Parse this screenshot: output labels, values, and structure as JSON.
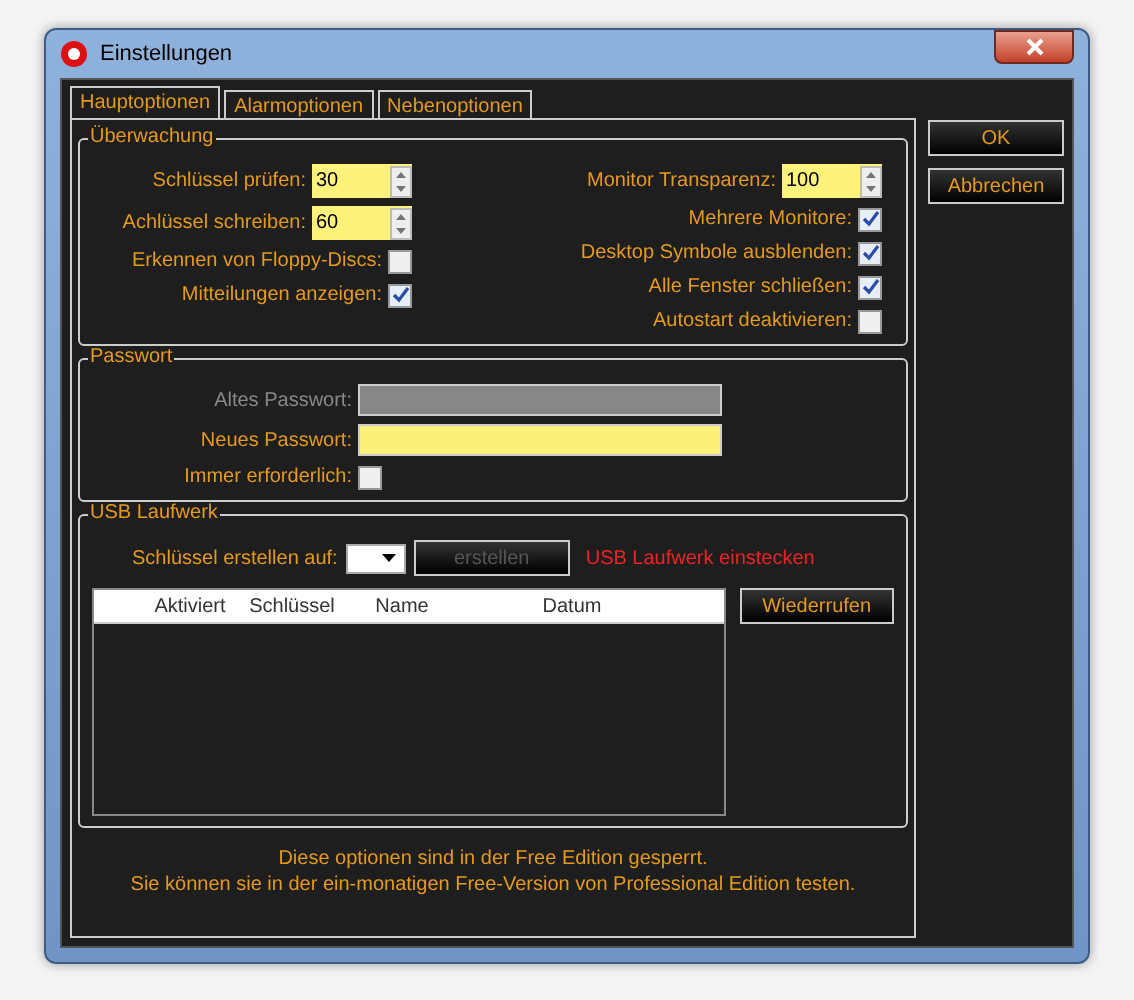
{
  "window": {
    "title": "Einstellungen"
  },
  "tabs": [
    {
      "label": "Hauptoptionen",
      "selected": true
    },
    {
      "label": "Alarmoptionen",
      "selected": false
    },
    {
      "label": "Nebenoptionen",
      "selected": false
    }
  ],
  "side_buttons": [
    "OK",
    "Abbrechen"
  ],
  "ueberwachung": {
    "title": "Überwachung",
    "left": [
      {
        "kind": "spinner",
        "label": "Schlüssel prüfen:",
        "value": "30"
      },
      {
        "kind": "spinner",
        "label": "Achlüssel schreiben:",
        "value": "60"
      },
      {
        "kind": "checkbox",
        "label": "Erkennen von Floppy-Discs:",
        "checked": false
      },
      {
        "kind": "checkbox",
        "label": "Mitteilungen anzeigen:",
        "checked": true
      }
    ],
    "right": [
      {
        "kind": "spinner",
        "label": "Monitor Transparenz:",
        "value": "100"
      },
      {
        "kind": "checkbox",
        "label": "Mehrere Monitore:",
        "checked": true
      },
      {
        "kind": "checkbox",
        "label": "Desktop Symbole ausblenden:",
        "checked": true
      },
      {
        "kind": "checkbox",
        "label": "Alle Fenster schließen:",
        "checked": true
      },
      {
        "kind": "checkbox",
        "label": "Autostart deaktivieren:",
        "checked": false
      }
    ]
  },
  "passwort": {
    "title": "Passwort",
    "rows": [
      {
        "kind": "text",
        "label": "Altes Passwort:",
        "disabled": true
      },
      {
        "kind": "text",
        "label": "Neues Passwort:",
        "disabled": false
      },
      {
        "kind": "checkbox",
        "label": "Immer erforderlich:",
        "checked": false
      }
    ]
  },
  "usb": {
    "title": "USB Laufwerk",
    "target_label": "Schlüssel erstellen auf:",
    "create_button": {
      "label": "erstellen",
      "disabled": true
    },
    "warning": "USB Laufwerk einstecken",
    "table": {
      "columns": [
        "Aktiviert",
        "Schlüssel",
        "Name",
        "Datum"
      ]
    },
    "revoke_button": "Wiederrufen"
  },
  "notice": [
    "Diese optionen sind in der Free Edition gesperrt.",
    "Sie können sie in der ein-monatigen Free-Version von Professional Edition testen."
  ]
}
